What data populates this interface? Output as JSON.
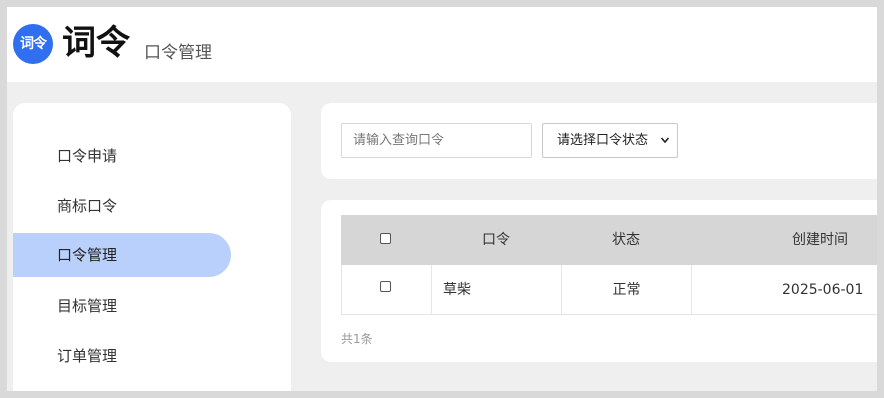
{
  "header": {
    "logo_text": "词令",
    "brand_title": "词令",
    "page_subtitle": "口令管理"
  },
  "sidebar": {
    "items": [
      {
        "label": "口令申请",
        "active": false
      },
      {
        "label": "商标口令",
        "active": false
      },
      {
        "label": "口令管理",
        "active": true
      },
      {
        "label": "目标管理",
        "active": false
      },
      {
        "label": "订单管理",
        "active": false
      }
    ]
  },
  "filters": {
    "search_placeholder": "请输入查询口令",
    "search_value": "",
    "status_select": "请选择口令状态"
  },
  "table": {
    "headers": {
      "select_all": "",
      "command": "口令",
      "status": "状态",
      "created_time": "创建时间"
    },
    "rows": [
      {
        "command": "草柴",
        "status": "正常",
        "created_time": "2025-06-01"
      }
    ],
    "total_text": "共1条"
  },
  "colors": {
    "accent": "#2f6ff0",
    "active_menu_bg": "#b8d0fb",
    "table_header_bg": "#d6d6d6",
    "page_bg": "#efeff0"
  }
}
